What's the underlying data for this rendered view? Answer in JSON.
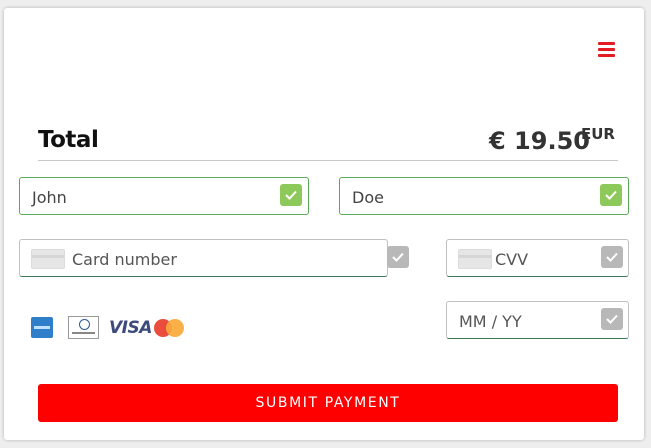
{
  "colors": {
    "accent": "#ff0000",
    "menu": "#e31b23",
    "valid": "#8dc95a",
    "pending": "#b8b8b8"
  },
  "menu": {
    "icon": "hamburger-icon"
  },
  "summary": {
    "total_label": "Total",
    "amount": "€ 19.50",
    "currency": "EUR"
  },
  "form": {
    "first_name": {
      "value": "John",
      "status": "valid"
    },
    "last_name": {
      "value": "Doe",
      "status": "valid"
    },
    "card_number": {
      "placeholder": "Card number",
      "status": "pending"
    },
    "cvv": {
      "placeholder": "CVV",
      "status": "pending"
    },
    "expiry": {
      "placeholder": "MM / YY",
      "status": "pending"
    }
  },
  "brands": [
    {
      "name": "American Express",
      "icon": "amex-icon"
    },
    {
      "name": "Diners Club International",
      "icon": "diners-club-icon"
    },
    {
      "name": "VISA",
      "icon": "visa-icon"
    },
    {
      "name": "Mastercard",
      "icon": "mastercard-icon"
    }
  ],
  "submit_label": "SUBMIT PAYMENT"
}
